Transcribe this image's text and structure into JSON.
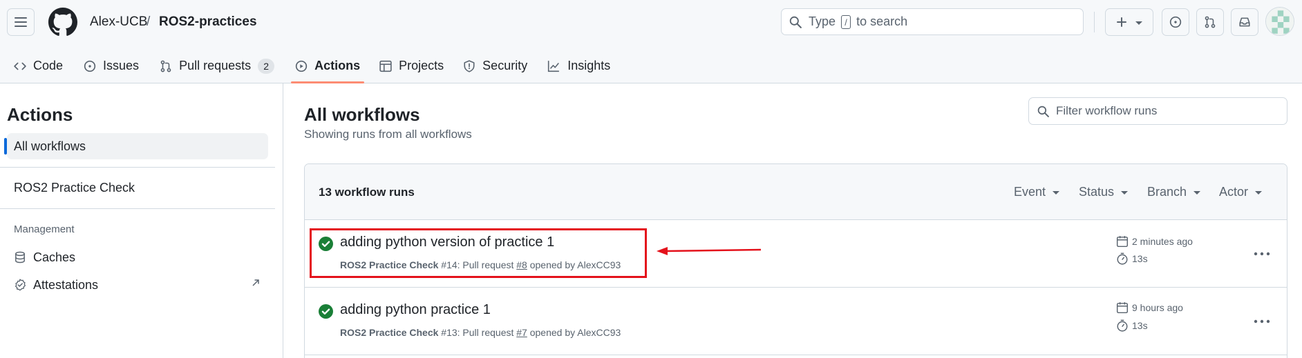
{
  "header": {
    "owner": "Alex-UCB",
    "separator": "/",
    "repo": "ROS2-practices",
    "search_prefix": "Type",
    "search_key": "/",
    "search_suffix": "to search"
  },
  "repo_tabs": [
    {
      "label": "Code",
      "icon": "code-icon"
    },
    {
      "label": "Issues",
      "icon": "issue-opened-icon"
    },
    {
      "label": "Pull requests",
      "icon": "git-pull-request-icon",
      "count": "2"
    },
    {
      "label": "Actions",
      "icon": "play-icon",
      "active": true
    },
    {
      "label": "Projects",
      "icon": "table-icon"
    },
    {
      "label": "Security",
      "icon": "shield-icon"
    },
    {
      "label": "Insights",
      "icon": "graph-icon"
    }
  ],
  "sidebar": {
    "title": "Actions",
    "all_workflows": "All workflows",
    "workflow": "ROS2 Practice Check",
    "group_label": "Management",
    "caches": "Caches",
    "attestations": "Attestations"
  },
  "main": {
    "title": "All workflows",
    "subtitle": "Showing runs from all workflows",
    "filter_placeholder": "Filter workflow runs",
    "runs_count": "13 workflow runs",
    "filters": [
      "Event",
      "Status",
      "Branch",
      "Actor"
    ]
  },
  "runs": [
    {
      "title": "adding python version of practice 1",
      "workflow": "ROS2 Practice Check",
      "number_text": "#14: Pull request",
      "pr": "#8",
      "opened_by": "opened by AlexCC93",
      "time_ago": "2 minutes ago",
      "duration": "13s",
      "status": "success"
    },
    {
      "title": "adding python practice 1",
      "workflow": "ROS2 Practice Check",
      "number_text": "#13: Pull request",
      "pr": "#7",
      "opened_by": "opened by AlexCC93",
      "time_ago": "9 hours ago",
      "duration": "13s",
      "status": "success"
    }
  ],
  "colors": {
    "accent_blue": "#0969da",
    "success_green": "#1a7f37",
    "tab_underline": "#fd8c73",
    "annotation_red": "#e4111b"
  }
}
